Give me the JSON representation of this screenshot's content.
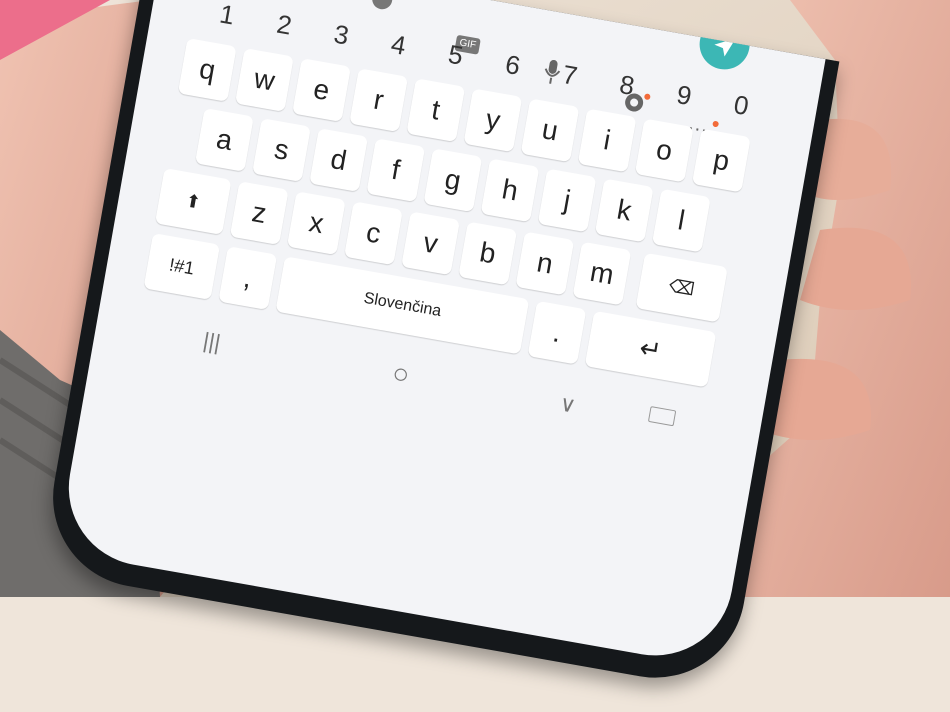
{
  "keyboard": {
    "toolbar": {
      "gif_label": "GIF",
      "more_label": "···"
    },
    "digit_row": [
      "1",
      "2",
      "3",
      "4",
      "5",
      "6",
      "7",
      "8",
      "9",
      "0"
    ],
    "row_q": [
      "q",
      "w",
      "e",
      "r",
      "t",
      "y",
      "u",
      "i",
      "o",
      "p"
    ],
    "row_a": [
      "a",
      "s",
      "d",
      "f",
      "g",
      "h",
      "j",
      "k",
      "l"
    ],
    "row_z": [
      "z",
      "x",
      "c",
      "v",
      "b",
      "n",
      "m"
    ],
    "symbols_label": "!#1",
    "comma_label": ",",
    "space_label": "Slovenčina",
    "period_label": ".",
    "shift_label": "⬆",
    "backspace_label": "⌫",
    "enter_label": "↵"
  },
  "navbar": {
    "recents_label": "|||",
    "home_label": "○",
    "back_label": "∨"
  },
  "colors": {
    "screen": "#f3f4f7",
    "key": "#ffffff",
    "accent_teal": "#3cb7b5",
    "notification_dot": "#f26b3a",
    "bezel": "#15181b"
  }
}
